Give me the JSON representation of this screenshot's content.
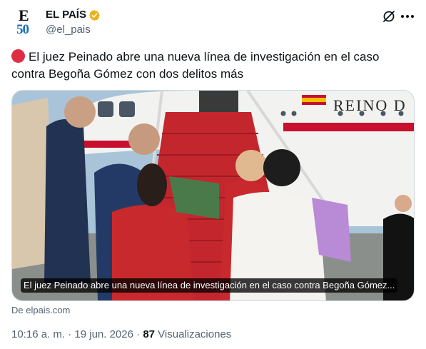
{
  "account": {
    "name": "EL PAÍS",
    "handle": "@el_pais",
    "avatar_letter": "E",
    "avatar_number": "50",
    "verified_color": "#e8b21c"
  },
  "header_actions": {
    "grok_icon": "grok-icon",
    "more_icon": "more-options-icon"
  },
  "tweet": {
    "emoji": "red-circle",
    "text": "El juez Peinado abre una nueva línea de investigación en el caso contra Begoña Gómez con dos delitos más"
  },
  "card": {
    "caption": "El juez Peinado abre una nueva línea de investigación en el caso contra Begoña Gómez...",
    "source": "De elpais.com",
    "image_description_icon": "news-photo"
  },
  "meta": {
    "time": "10:16 a. m.",
    "separator1": " · ",
    "date": "19 jun. 2026",
    "separator2": " · ",
    "views_count": "87",
    "views_label": " Visualizaciones"
  },
  "colors": {
    "accent_red": "#dd2e44",
    "secondary_text": "#536471",
    "primary_text": "#0f1419"
  }
}
